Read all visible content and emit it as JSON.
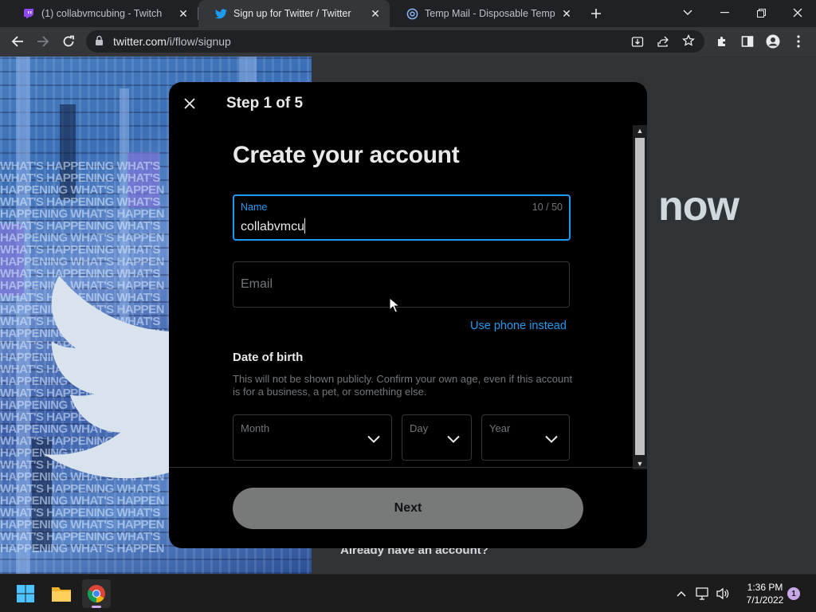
{
  "browser": {
    "tabs": [
      {
        "title": "(1) collabvmcubing - Twitch",
        "icon": "twitch-icon",
        "active": false
      },
      {
        "title": "Sign up for Twitter / Twitter",
        "icon": "twitter-bird-icon",
        "active": true
      },
      {
        "title": "Temp Mail - Disposable Tempora",
        "icon": "at-sign-icon",
        "active": false
      }
    ],
    "url_host": "twitter.com",
    "url_path": "/i/flow/signup"
  },
  "page": {
    "bg_text": "now",
    "already_text": "Already have an account?"
  },
  "modal": {
    "step": "Step 1 of 5",
    "heading": "Create your account",
    "name_field": {
      "label": "Name",
      "counter": "10 / 50",
      "value": "collabvmcu"
    },
    "email_field": {
      "placeholder": "Email"
    },
    "use_phone": "Use phone instead",
    "dob": {
      "title": "Date of birth",
      "description": "This will not be shown publicly. Confirm your own age, even if this account is for a business, a pet, or something else.",
      "month_label": "Month",
      "day_label": "Day",
      "year_label": "Year"
    },
    "next_label": "Next"
  },
  "taskbar": {
    "time": "1:36 PM",
    "date": "7/1/2022",
    "notifications": "1"
  },
  "colors": {
    "accent": "#1d9bf0",
    "modal_bg": "#000000",
    "next_button_bg": "#787a7a"
  }
}
